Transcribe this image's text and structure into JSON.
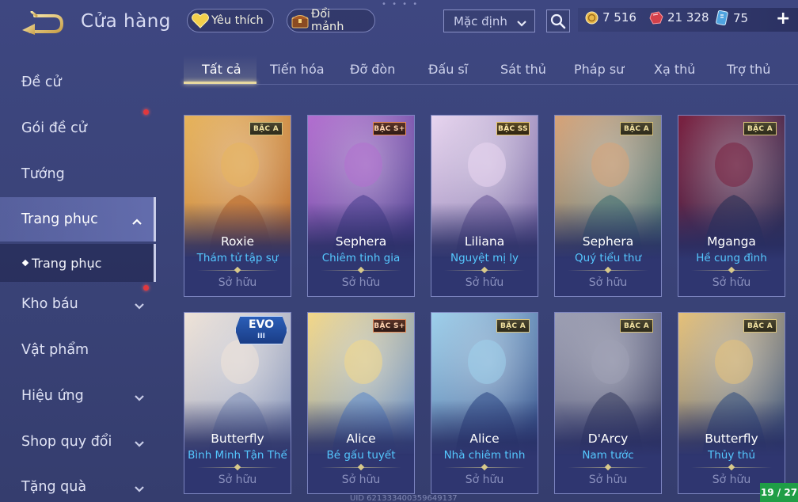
{
  "header": {
    "title": "Cửa hàng",
    "favorites_label": "Yêu thích",
    "fragments_label": "Đổi mảnh",
    "sort_value": "Mặc định"
  },
  "currency": {
    "gold": "7 516",
    "ruby": "21 328",
    "voucher": "75"
  },
  "tabs": [
    {
      "label": "Tất cả",
      "active": true
    },
    {
      "label": "Tiến hóa"
    },
    {
      "label": "Đỡ đòn"
    },
    {
      "label": "Đấu sĩ"
    },
    {
      "label": "Sát thủ"
    },
    {
      "label": "Pháp sư"
    },
    {
      "label": "Xạ thủ"
    },
    {
      "label": "Trợ thủ"
    }
  ],
  "sidebar": {
    "items": [
      {
        "label": "Đề cử"
      },
      {
        "label": "Gói đề cử",
        "notification": true
      },
      {
        "label": "Tướng"
      },
      {
        "label": "Trang phục",
        "active": true,
        "expanded": true
      },
      {
        "label": "Kho báu",
        "notification": true,
        "has_chevron": true
      },
      {
        "label": "Vật phẩm"
      },
      {
        "label": "Hiệu ứng",
        "has_chevron": true
      },
      {
        "label": "Shop quy đổi",
        "has_chevron": true
      },
      {
        "label": "Tặng quà",
        "has_chevron": true
      }
    ],
    "subitem": {
      "label": "Trang phục"
    }
  },
  "cards": [
    {
      "hero": "Roxie",
      "skin": "Thám tử tập sự",
      "status": "Sở hữu",
      "tier": "BẬC A",
      "colors": [
        "#b8672a",
        "#e7b45c"
      ]
    },
    {
      "hero": "Sephera",
      "skin": "Chiêm tinh gia",
      "status": "Sở hữu",
      "tier": "BẬC S+",
      "colors": [
        "#4b3f8f",
        "#b36fd0"
      ]
    },
    {
      "hero": "Liliana",
      "skin": "Nguyệt mị ly",
      "status": "Sở hữu",
      "tier": "BẬC SS",
      "colors": [
        "#6a5a9a",
        "#e9d6f0"
      ]
    },
    {
      "hero": "Sephera",
      "skin": "Quý tiểu thư",
      "status": "Sở hữu",
      "tier": "BẬC A",
      "colors": [
        "#3f6e72",
        "#d8a479"
      ]
    },
    {
      "hero": "Mganga",
      "skin": "Hề cung đình",
      "status": "Sở hữu",
      "tier": "BẬC A",
      "colors": [
        "#2a2f55",
        "#7a2140"
      ]
    },
    {
      "hero": "Butterfly",
      "skin": "Bình Minh Tận Thế",
      "status": "Sở hữu",
      "evo": "EVO",
      "evo_level": "III",
      "colors": [
        "#7e8fb8",
        "#f0e4d8"
      ]
    },
    {
      "hero": "Alice",
      "skin": "Bé gấu tuyết",
      "status": "Sở hữu",
      "tier": "BẬC S+",
      "colors": [
        "#5d88c8",
        "#f4d889"
      ]
    },
    {
      "hero": "Alice",
      "skin": "Nhà chiêm tinh",
      "status": "Sở hữu",
      "tier": "BẬC A",
      "colors": [
        "#2f4a86",
        "#9fd1ec"
      ]
    },
    {
      "hero": "D'Arcy",
      "skin": "Nam tước",
      "status": "Sở hữu",
      "tier": "BẬC A",
      "colors": [
        "#3b3f63",
        "#9ea0b4"
      ]
    },
    {
      "hero": "Butterfly",
      "skin": "Thủy thủ",
      "status": "Sở hữu",
      "tier": "BẬC A",
      "colors": [
        "#35507e",
        "#e7c27a"
      ]
    }
  ],
  "footer": {
    "uid": "UID 621333400359649137",
    "page": "19 / 27"
  },
  "theme": {
    "accent": "#e8d9a0",
    "skin_name_color": "#55c8ff",
    "background": "#3c457c"
  }
}
